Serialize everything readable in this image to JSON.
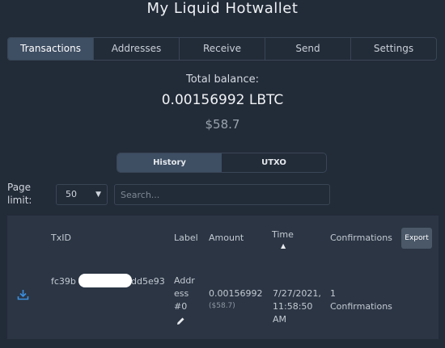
{
  "app": {
    "title": "My Liquid Hotwallet"
  },
  "main_tabs": [
    "Transactions",
    "Addresses",
    "Receive",
    "Send",
    "Settings"
  ],
  "balance": {
    "label": "Total balance:",
    "value": "0.00156992 LBTC",
    "usd": "$58.7"
  },
  "sub_tabs": [
    "History",
    "UTXO"
  ],
  "filters": {
    "page_limit_label": "Page limit:",
    "page_limit_value": "50",
    "search_placeholder": "Search..."
  },
  "table": {
    "headers": {
      "txid": "TxID",
      "label": "Label",
      "amount": "Amount",
      "time": "Time",
      "confirmations": "Confirmations"
    },
    "export_label": "Export",
    "rows": [
      {
        "txid_start": "fc39b",
        "txid_end": "dd5e93",
        "label_lines": [
          "Addr",
          "ess",
          "#0"
        ],
        "amount": "0.00156992",
        "amount_usd": "($58.7)",
        "time_lines": [
          "7/27/2021,",
          "11:58:50",
          "AM"
        ],
        "confirmations_lines": [
          "1",
          "Confirmations"
        ]
      }
    ]
  },
  "icons": {
    "download": "download-icon",
    "edit": "pencil-icon",
    "sort": "sort-up-icon",
    "chevron": "chevron-down-icon"
  },
  "colors": {
    "background": "#222b38",
    "panel": "#2b3544",
    "active_tab": "#3e4e63",
    "link_icon": "#3b8fe0"
  }
}
